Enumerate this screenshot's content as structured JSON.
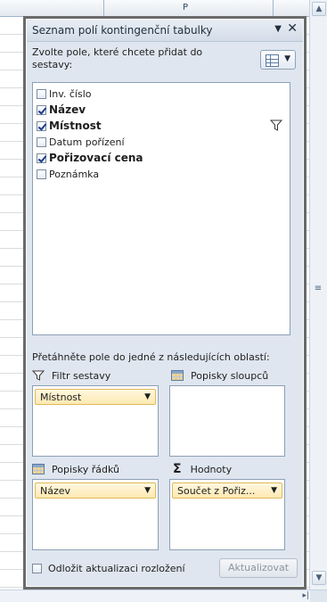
{
  "sheet": {
    "column_letter": "P"
  },
  "pane": {
    "title": "Seznam polí kontingenční tabulky",
    "choose_label": "Zvolte pole, které chcete přidat do sestavy:",
    "fields": [
      {
        "label": "Inv. číslo",
        "checked": false,
        "filtered": false
      },
      {
        "label": "Název",
        "checked": true,
        "filtered": false
      },
      {
        "label": "Místnost",
        "checked": true,
        "filtered": true
      },
      {
        "label": "Datum pořízení",
        "checked": false,
        "filtered": false
      },
      {
        "label": "Pořizovací cena",
        "checked": true,
        "filtered": false
      },
      {
        "label": "Poznámka",
        "checked": false,
        "filtered": false
      }
    ],
    "drag_label": "Přetáhněte pole do jedné z následujících oblastí:",
    "areas": {
      "report_filter": {
        "label": "Filtr sestavy",
        "icon": "filter-icon",
        "chip": "Místnost"
      },
      "column_labels": {
        "label": "Popisky sloupců",
        "icon": "table-icon",
        "chip": ""
      },
      "row_labels": {
        "label": "Popisky řádků",
        "icon": "table-icon",
        "chip": "Název"
      },
      "values": {
        "label": "Hodnoty",
        "icon": "sigma-icon",
        "chip": "Součet z Pořiz..."
      }
    },
    "defer_label": "Odložit aktualizaci rozložení",
    "defer_checked": false,
    "update_button": "Aktualizovat"
  },
  "colors": {
    "pane_background": "#dfe6ef",
    "chip_fill": "#fde9b2",
    "chip_border": "#e0b95a",
    "check_color": "#1f3b8f"
  }
}
